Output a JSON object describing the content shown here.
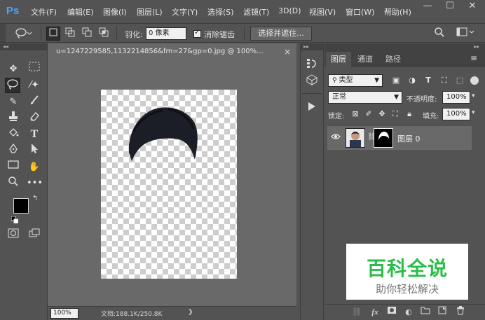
{
  "app": {
    "logo": "Ps"
  },
  "menu": [
    "文件(F)",
    "编辑(E)",
    "图像(I)",
    "图层(L)",
    "文字(Y)",
    "选择(S)",
    "滤镜(T)",
    "3D(D)",
    "视图(V)",
    "窗口(W)",
    "帮助(H)"
  ],
  "window_controls": {
    "minimize": "—",
    "restore": "☐",
    "close": "✕"
  },
  "options": {
    "feather_label": "羽化:",
    "feather_value": "0 像素",
    "antialias_label": "消除锯齿",
    "antialias_checked": true,
    "select_mask_button": "选择并遮住..."
  },
  "document": {
    "tab_title": "u=1247229585,1132214856&fm=27&gp=0.jpg @ 100%...",
    "close": "×",
    "zoom": "100%",
    "doc_info": "文档:188.1K/250.8K",
    "status_arrow": "❯",
    "hair_color": "#1c1e27"
  },
  "colors": {
    "foreground": "#000000",
    "background": "#ffffff"
  },
  "layers_panel": {
    "tabs": [
      "图层",
      "通道",
      "路径"
    ],
    "filter_kind": "类型",
    "blend_mode": "正常",
    "opacity_label": "不透明度:",
    "opacity_value": "100%",
    "lock_label": "锁定:",
    "fill_label": "填充:",
    "fill_value": "100%",
    "layers": [
      {
        "name": "图层 0",
        "visible": true
      }
    ],
    "bottom_icons": [
      "link-icon",
      "fx-icon",
      "mask-icon",
      "adjustment-icon",
      "folder-icon",
      "new-layer-icon",
      "trash-icon"
    ],
    "fx_label": "fx"
  },
  "watermark": {
    "title": "百科全说",
    "subtitle": "助你轻松解决",
    "accent": "#2bbd4a"
  }
}
